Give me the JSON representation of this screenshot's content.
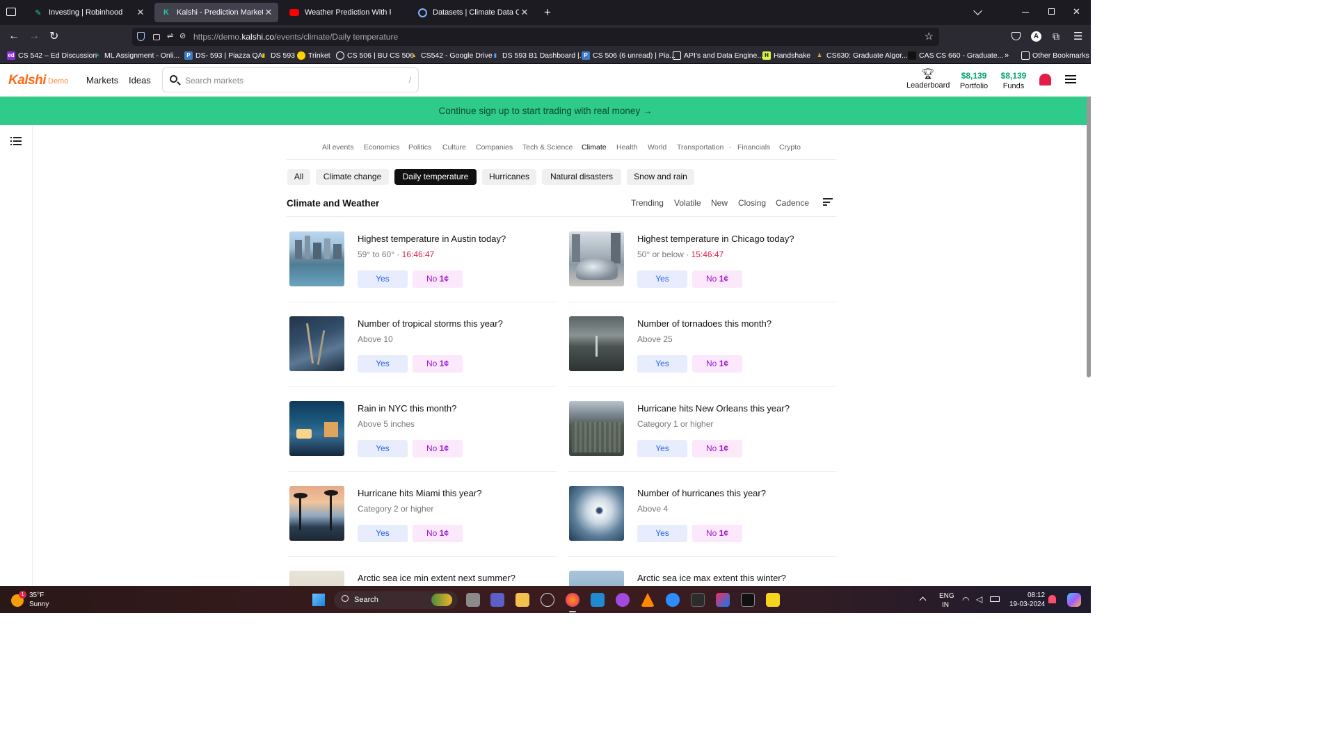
{
  "browser": {
    "tabs": [
      {
        "title": "Investing | Robinhood",
        "active": false
      },
      {
        "title": "Kalshi - Prediction Market for Tr",
        "active": true
      },
      {
        "title": "Weather Prediction With Pytho",
        "active": false
      },
      {
        "title": "Datasets | Climate Data Online |",
        "active": false
      }
    ],
    "new_tab": "+",
    "url_prefix": "https://demo.",
    "url_domain": "kalshi.co",
    "url_path": "/events/climate/Daily temperature",
    "bookmarks": [
      "CS 542 – Ed Discussion",
      "ML Assignment - Onli...",
      "DS- 593 | Piazza QA",
      "DS 593",
      "Trinket",
      "CS 506 | BU CS 506",
      "CS542 - Google Drive",
      "DS 593 B1 Dashboard |...",
      "CS 506 (6 unread) | Pia...",
      "API's and Data Engine...",
      "Handshake",
      "CS630: Graduate Algor...",
      "CAS CS 660 - Graduate...",
      "Other Bookmarks"
    ]
  },
  "header": {
    "brand": "Kalshi",
    "brand_tag": "Demo",
    "nav": [
      "Markets",
      "Ideas"
    ],
    "search_placeholder": "Search markets",
    "search_shortcut": "/",
    "leaderboard": "Leaderboard",
    "portfolio_value": "$8,139",
    "portfolio_label": "Portfolio",
    "funds_value": "$8,139",
    "funds_label": "Funds"
  },
  "banner": "Continue sign up to start trading with real money →",
  "categories": [
    "All events",
    "Economics",
    "Politics",
    "Culture",
    "Companies",
    "Tech & Science",
    "Climate",
    "Health",
    "World",
    "Transportation",
    "·",
    "Financials",
    "Crypto"
  ],
  "active_category": "Climate",
  "subcategories": [
    "All",
    "Climate change",
    "Daily temperature",
    "Hurricanes",
    "Natural disasters",
    "Snow and rain"
  ],
  "active_subcategory": "Daily temperature",
  "section_title": "Climate and Weather",
  "sort_options": [
    "Trending",
    "Volatile",
    "New",
    "Closing",
    "Cadence"
  ],
  "markets": [
    {
      "title": "Highest temperature in Austin today?",
      "subtitle": "59° to 60° · ",
      "time": "16:46:47",
      "yes": "Yes",
      "no": "No",
      "no_price": "1¢"
    },
    {
      "title": "Highest temperature in Chicago today?",
      "subtitle": "50° or below · ",
      "time": "15:46:47",
      "yes": "Yes",
      "no": "No",
      "no_price": "1¢"
    },
    {
      "title": "Number of tropical storms this year?",
      "subtitle": "Above 10",
      "time": "",
      "yes": "Yes",
      "no": "No",
      "no_price": "1¢"
    },
    {
      "title": "Number of tornadoes this month?",
      "subtitle": "Above 25",
      "time": "",
      "yes": "Yes",
      "no": "No",
      "no_price": "1¢"
    },
    {
      "title": "Rain in NYC this month?",
      "subtitle": "Above 5 inches",
      "time": "",
      "yes": "Yes",
      "no": "No",
      "no_price": "1¢"
    },
    {
      "title": "Hurricane hits New Orleans this year?",
      "subtitle": "Category 1 or higher",
      "time": "",
      "yes": "Yes",
      "no": "No",
      "no_price": "1¢"
    },
    {
      "title": "Hurricane hits Miami this year?",
      "subtitle": "Category 2 or higher",
      "time": "",
      "yes": "Yes",
      "no": "No",
      "no_price": "1¢"
    },
    {
      "title": "Number of hurricanes this year?",
      "subtitle": "Above 4",
      "time": "",
      "yes": "Yes",
      "no": "No",
      "no_price": "1¢"
    },
    {
      "title": "Arctic sea ice min extent next summer?",
      "subtitle": "",
      "time": "",
      "yes": "",
      "no": "",
      "no_price": ""
    },
    {
      "title": "Arctic sea ice max extent this winter?",
      "subtitle": "",
      "time": "",
      "yes": "",
      "no": "",
      "no_price": ""
    }
  ],
  "taskbar": {
    "weather_temp": "35°F",
    "weather_desc": "Sunny",
    "weather_badge": "1",
    "search_label": "Search",
    "lang": "ENG",
    "region": "IN",
    "time": "08:12",
    "date": "19-03-2024"
  },
  "colors": {
    "brand": "#ff6b1a",
    "banner": "#2ecb8a",
    "money": "#00a56a",
    "yes": "#2563eb",
    "no": "#9b17d1",
    "timer": "#e11d48"
  }
}
